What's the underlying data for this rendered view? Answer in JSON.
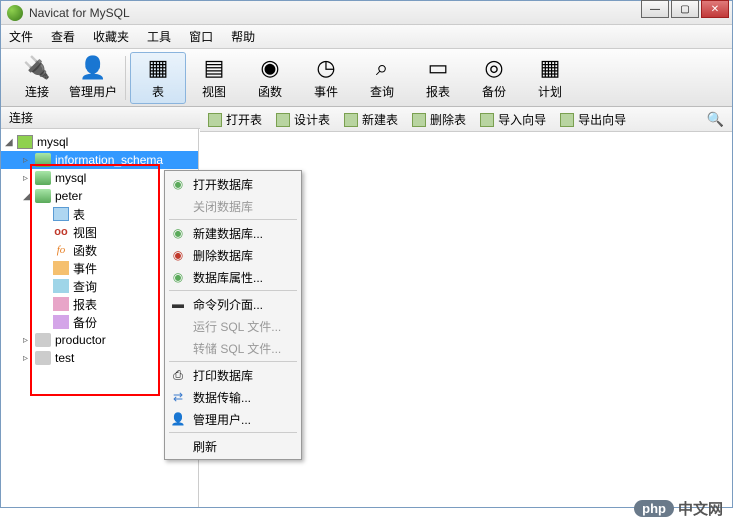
{
  "title": "Navicat for MySQL",
  "menu": [
    "文件",
    "查看",
    "收藏夹",
    "工具",
    "窗口",
    "帮助"
  ],
  "toolbar": [
    {
      "label": "连接",
      "icon": "🔌",
      "name": "connect-button"
    },
    {
      "label": "管理用户",
      "icon": "👤",
      "name": "manage-users-button"
    },
    {
      "label": "表",
      "icon": "▦",
      "name": "table-button",
      "active": true,
      "sep_before": true
    },
    {
      "label": "视图",
      "icon": "▤",
      "name": "view-button"
    },
    {
      "label": "函数",
      "icon": "◉",
      "name": "function-button"
    },
    {
      "label": "事件",
      "icon": "◷",
      "name": "event-button"
    },
    {
      "label": "查询",
      "icon": "⌕",
      "name": "query-button"
    },
    {
      "label": "报表",
      "icon": "▭",
      "name": "report-button"
    },
    {
      "label": "备份",
      "icon": "◎",
      "name": "backup-button"
    },
    {
      "label": "计划",
      "icon": "▦",
      "name": "schedule-button"
    }
  ],
  "conn_label": "连接",
  "subtoolbar": [
    {
      "label": "打开表",
      "name": "open-table-button"
    },
    {
      "label": "设计表",
      "name": "design-table-button"
    },
    {
      "label": "新建表",
      "name": "new-table-button"
    },
    {
      "label": "删除表",
      "name": "delete-table-button"
    },
    {
      "label": "导入向导",
      "name": "import-wizard-button"
    },
    {
      "label": "导出向导",
      "name": "export-wizard-button"
    }
  ],
  "tree": {
    "root": "mysql",
    "items": [
      {
        "label": "information_schema",
        "type": "db",
        "indent": 1,
        "selected": true,
        "name": "db-information-schema"
      },
      {
        "label": "mysql",
        "type": "db",
        "indent": 1,
        "name": "db-mysql"
      },
      {
        "label": "peter",
        "type": "db",
        "indent": 1,
        "expanded": true,
        "active": true,
        "name": "db-peter"
      },
      {
        "label": "表",
        "type": "table",
        "indent": 2,
        "name": "node-tables"
      },
      {
        "label": "视图",
        "type": "view",
        "indent": 2,
        "name": "node-views"
      },
      {
        "label": "函数",
        "type": "func",
        "indent": 2,
        "name": "node-functions"
      },
      {
        "label": "事件",
        "type": "event",
        "indent": 2,
        "name": "node-events"
      },
      {
        "label": "查询",
        "type": "query",
        "indent": 2,
        "name": "node-queries"
      },
      {
        "label": "报表",
        "type": "report",
        "indent": 2,
        "name": "node-reports"
      },
      {
        "label": "备份",
        "type": "backup",
        "indent": 2,
        "name": "node-backups"
      },
      {
        "label": "productor",
        "type": "db-gray",
        "indent": 1,
        "name": "db-productor"
      },
      {
        "label": "test",
        "type": "db-gray",
        "indent": 1,
        "name": "db-test"
      }
    ]
  },
  "context_menu": [
    {
      "label": "打开数据库",
      "icon": "◉",
      "color": "#5aaa5a",
      "name": "ctx-open-db"
    },
    {
      "label": "关闭数据库",
      "disabled": true,
      "name": "ctx-close-db"
    },
    {
      "sep": true
    },
    {
      "label": "新建数据库...",
      "icon": "◉",
      "color": "#5aaa5a",
      "name": "ctx-new-db"
    },
    {
      "label": "删除数据库",
      "icon": "◉",
      "color": "#c0392b",
      "name": "ctx-delete-db"
    },
    {
      "label": "数据库属性...",
      "icon": "◉",
      "color": "#5aaa5a",
      "name": "ctx-db-properties"
    },
    {
      "sep": true
    },
    {
      "label": "命令列介面...",
      "icon": "▬",
      "color": "#333",
      "name": "ctx-cli"
    },
    {
      "label": "运行 SQL 文件...",
      "disabled": true,
      "name": "ctx-run-sql"
    },
    {
      "label": "转储 SQL 文件...",
      "disabled": true,
      "name": "ctx-dump-sql"
    },
    {
      "sep": true
    },
    {
      "label": "打印数据库",
      "icon": "⎙",
      "name": "ctx-print-db"
    },
    {
      "label": "数据传输...",
      "icon": "⇄",
      "color": "#3a7acc",
      "name": "ctx-data-transfer"
    },
    {
      "label": "管理用户...",
      "icon": "👤",
      "name": "ctx-manage-users"
    },
    {
      "sep": true
    },
    {
      "label": "刷新",
      "name": "ctx-refresh"
    }
  ],
  "watermark": {
    "badge": "php",
    "text": "中文网"
  }
}
